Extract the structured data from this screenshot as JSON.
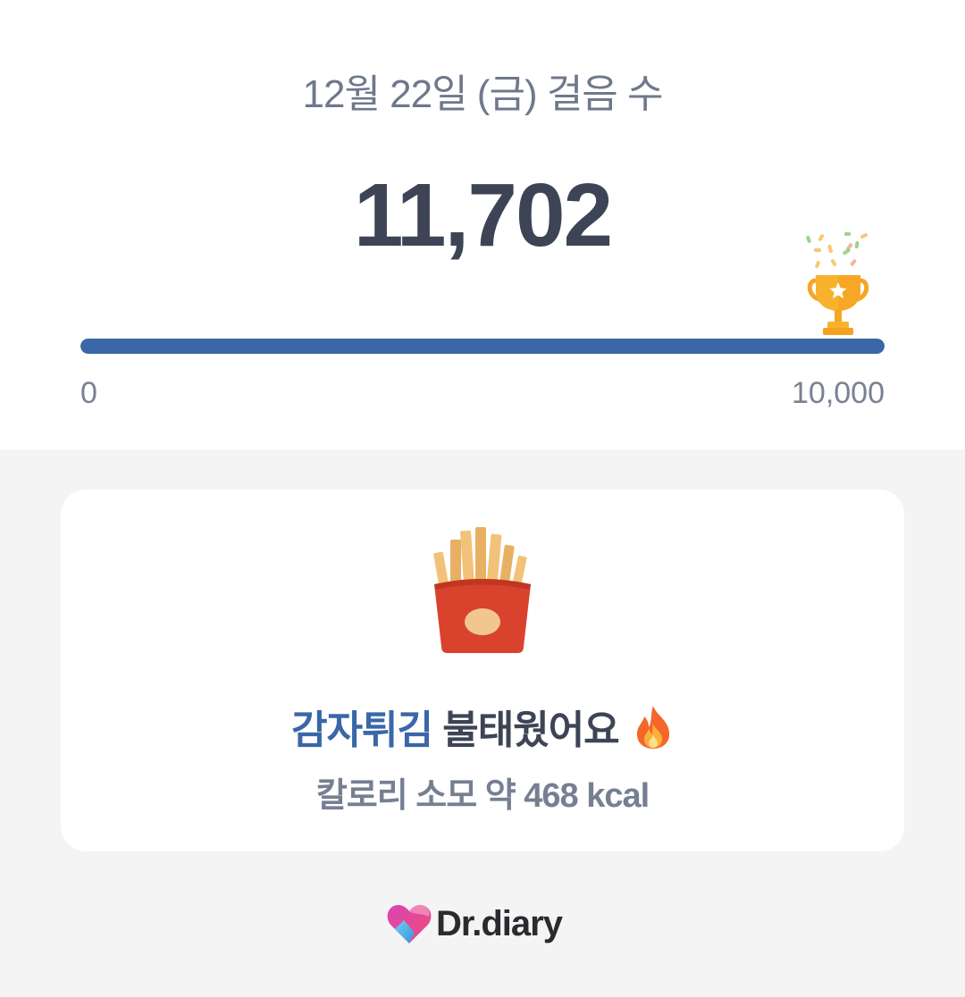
{
  "header": {
    "date_title": "12월 22일 (금) 걸음 수",
    "step_count": "11,702"
  },
  "progress": {
    "min_label": "0",
    "max_label": "10,000",
    "value": 11702,
    "goal": 10000,
    "fill_fraction": 1.0,
    "fill_color": "#3a67a7",
    "goal_icon": "trophy-icon"
  },
  "card": {
    "food_icon": "french-fries-icon",
    "food_name": "감자튀김",
    "burn_text": "불태웠어요",
    "fire_icon": "fire-icon",
    "calorie_text": "칼로리 소모 약 468 kcal"
  },
  "brand": {
    "name": "Dr.diary",
    "logo_icon": "heart-logo-icon"
  },
  "colors": {
    "accent": "#3a67a7",
    "text_dark": "#3d4455",
    "text_muted": "#6f788c",
    "background": "#f4f4f4"
  }
}
